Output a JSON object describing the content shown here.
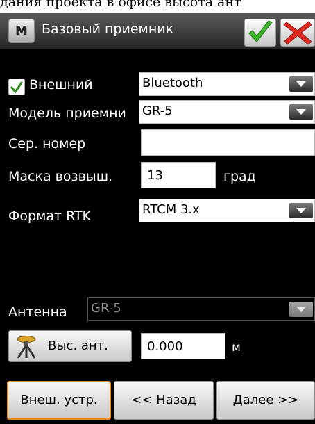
{
  "top_caption": "дания проекта в офисе высота ант",
  "title_bar": {
    "logo_letter": "M",
    "title": "Базовый приемник",
    "ok_icon": "check-icon",
    "cancel_icon": "close-icon",
    "ok_color": "#3fb92b",
    "cancel_color": "#e12a1f"
  },
  "external": {
    "label": "Внешний",
    "checked": true,
    "connection_value": "Bluetooth"
  },
  "model": {
    "label": "Модель приемни",
    "value": "GR-5"
  },
  "serial": {
    "label": "Сер. номер",
    "value": ""
  },
  "elevation_mask": {
    "label": "Маска возвыш.",
    "value": "13",
    "unit": "град"
  },
  "rtk_format": {
    "label": "Формат RTK",
    "value": "RTCM 3.x"
  },
  "antenna": {
    "label": "Антенна",
    "value": "GR-5"
  },
  "antenna_height": {
    "button_label": "Выс. ант.",
    "value": "0.000",
    "unit": "м"
  },
  "footer": {
    "ext_devices": "Внеш. устр.",
    "back": "<< Назад",
    "next": "Далее >>"
  }
}
